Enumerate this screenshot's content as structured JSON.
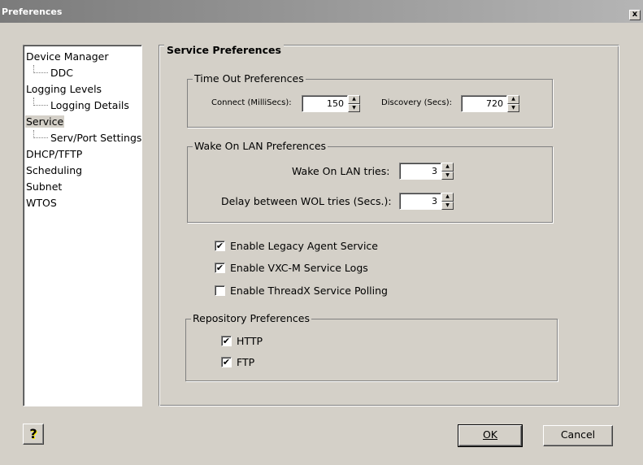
{
  "window": {
    "title": "Preferences",
    "close_symbol": "x"
  },
  "tree": {
    "items": [
      {
        "label": "Device Manager",
        "level": 0
      },
      {
        "label": "DDC",
        "level": 1
      },
      {
        "label": "Logging Levels",
        "level": 0
      },
      {
        "label": "Logging Details",
        "level": 1
      },
      {
        "label": "Service",
        "level": 0,
        "selected": true
      },
      {
        "label": "Serv/Port Settings",
        "level": 1
      },
      {
        "label": "DHCP/TFTP",
        "level": 0
      },
      {
        "label": "Scheduling",
        "level": 0
      },
      {
        "label": "Subnet",
        "level": 0
      },
      {
        "label": "WTOS",
        "level": 0
      }
    ]
  },
  "service": {
    "title": "Service Preferences",
    "timeout": {
      "title": "Time Out Preferences",
      "connect_label": "Connect (MilliSecs):",
      "connect_value": "150",
      "discovery_label": "Discovery (Secs):",
      "discovery_value": "720"
    },
    "wol": {
      "title": "Wake On LAN Preferences",
      "tries_label": "Wake On LAN tries:",
      "tries_value": "3",
      "delay_label": "Delay between WOL tries (Secs.):",
      "delay_value": "3"
    },
    "options": {
      "legacy_label": "Enable Legacy Agent Service",
      "legacy_checked": true,
      "vxc_label": "Enable VXC-M Service Logs",
      "vxc_checked": true,
      "threadx_label": "Enable ThreadX Service Polling",
      "threadx_checked": false
    },
    "repository": {
      "title": "Repository Preferences",
      "http_label": "HTTP",
      "http_checked": true,
      "ftp_label": "FTP",
      "ftp_checked": true
    }
  },
  "buttons": {
    "help_symbol": "?",
    "ok_label": "OK",
    "cancel_label": "Cancel"
  },
  "glyphs": {
    "check": "✔",
    "up": "▲",
    "down": "▼"
  }
}
